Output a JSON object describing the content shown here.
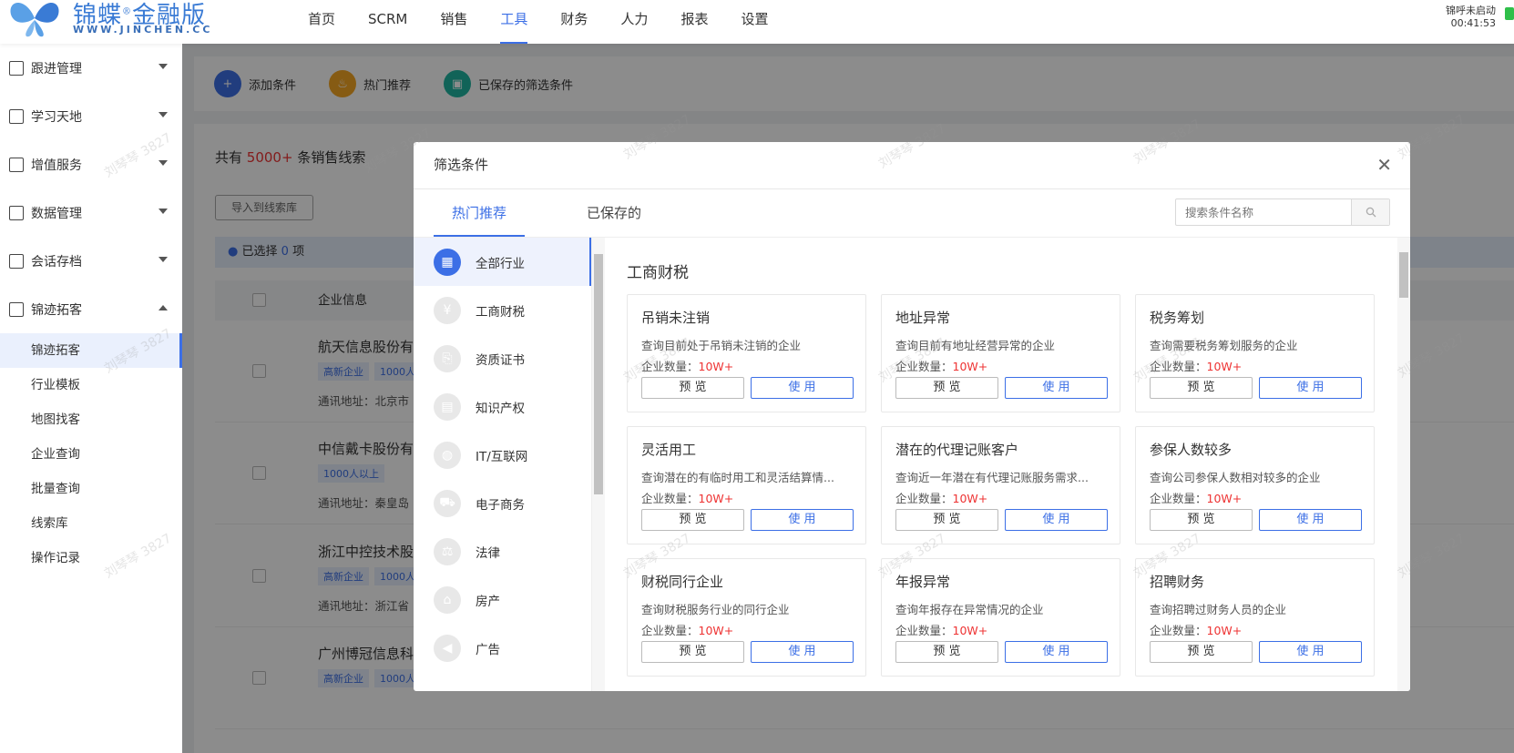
{
  "brand": {
    "name": "锦蝶",
    "edition": "金融版",
    "url": "WWW.JINCHEN.CC"
  },
  "nav": [
    "首页",
    "SCRM",
    "销售",
    "工具",
    "财务",
    "人力",
    "报表",
    "设置"
  ],
  "call": {
    "status": "锦呼未启动",
    "time": "00:41:53"
  },
  "sidebar": {
    "groups": [
      {
        "label": "跟进管理",
        "icon": "follow-icon"
      },
      {
        "label": "学习天地",
        "icon": "book-icon"
      },
      {
        "label": "增值服务",
        "icon": "service-icon"
      },
      {
        "label": "数据管理",
        "icon": "data-icon"
      },
      {
        "label": "会话存档",
        "icon": "chat-archive-icon"
      },
      {
        "label": "锦迹拓客",
        "icon": "expand-icon"
      }
    ],
    "subs": [
      "锦迹拓客",
      "行业模板",
      "地图找客",
      "企业查询",
      "批量查询",
      "线索库",
      "操作记录"
    ]
  },
  "toolbar": {
    "add": "添加条件",
    "hot": "热门推荐",
    "saved": "已保存的筛选条件"
  },
  "list": {
    "count_prefix": "共有",
    "count": "5000+",
    "count_suffix": "条销售线索",
    "import": "导入到线索库",
    "selected_prefix": "已选择",
    "selected": "0",
    "selected_suffix": "项",
    "col_company": "企业信息",
    "rows": [
      {
        "name": "航天信息股份有",
        "tags": [
          "高新企业",
          "1000人"
        ],
        "addr": "通讯地址：北京市"
      },
      {
        "name": "中信戴卡股份有",
        "tags": [
          "1000人以上"
        ],
        "addr": "通讯地址：秦皇岛"
      },
      {
        "name": "浙江中控技术股",
        "tags": [
          "高新企业",
          "1000人"
        ],
        "addr": "通讯地址：浙江省"
      },
      {
        "name": "广州博冠信息科",
        "tags": [
          "高新企业",
          "1000人"
        ],
        "addr": ""
      }
    ]
  },
  "modal": {
    "title": "筛选条件",
    "tabs": [
      "热门推荐",
      "已保存的"
    ],
    "search_placeholder": "搜索条件名称",
    "categories": [
      "全部行业",
      "工商财税",
      "资质证书",
      "知识产权",
      "IT/互联网",
      "电子商务",
      "法律",
      "房产",
      "广告"
    ],
    "section": "工商财税",
    "qty_label": "企业数量：",
    "preview": "预 览",
    "use": "使 用",
    "cards": [
      {
        "title": "吊销未注销",
        "desc": "查询目前处于吊销未注销的企业",
        "qty": "10W+"
      },
      {
        "title": "地址异常",
        "desc": "查询目前有地址经营异常的企业",
        "qty": "10W+"
      },
      {
        "title": "税务筹划",
        "desc": "查询需要税务筹划服务的企业",
        "qty": "10W+"
      },
      {
        "title": "灵活用工",
        "desc": "查询潜在的有临时用工和灵活结算情...",
        "qty": "10W+"
      },
      {
        "title": "潜在的代理记账客户",
        "desc": "查询近一年潜在有代理记账服务需求...",
        "qty": "10W+"
      },
      {
        "title": "参保人数较多",
        "desc": "查询公司参保人数相对较多的企业",
        "qty": "10W+"
      },
      {
        "title": "财税同行企业",
        "desc": "查询财税服务行业的同行企业",
        "qty": "10W+"
      },
      {
        "title": "年报异常",
        "desc": "查询年报存在异常情况的企业",
        "qty": "10W+"
      },
      {
        "title": "招聘财务",
        "desc": "查询招聘过财务人员的企业",
        "qty": "10W+"
      }
    ]
  },
  "watermark": "刘琴琴 3827",
  "colors": {
    "accent": "#3c6fe6",
    "highlight": "#e33"
  }
}
